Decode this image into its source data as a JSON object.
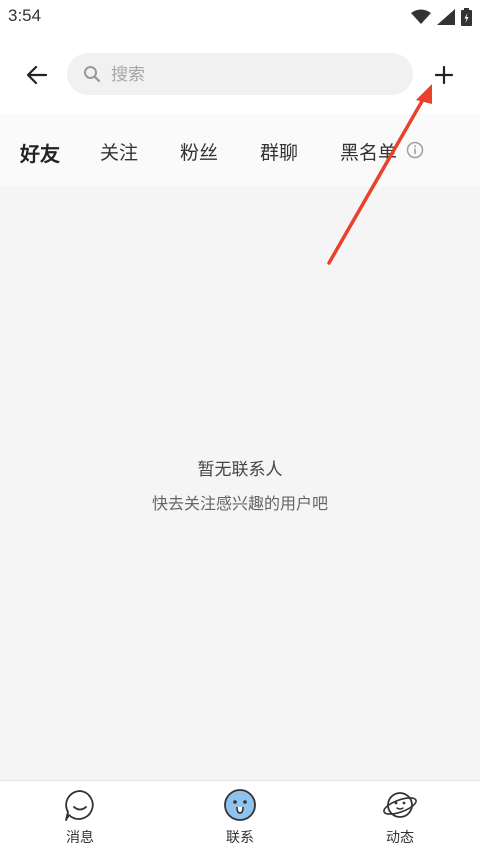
{
  "status_bar": {
    "time": "3:54"
  },
  "header": {
    "search_placeholder": "搜索"
  },
  "tabs": [
    {
      "label": "好友",
      "active": true
    },
    {
      "label": "关注",
      "active": false
    },
    {
      "label": "粉丝",
      "active": false
    },
    {
      "label": "群聊",
      "active": false
    },
    {
      "label": "黑名单",
      "active": false
    }
  ],
  "empty_state": {
    "title": "暂无联系人",
    "subtitle": "快去关注感兴趣的用户吧"
  },
  "bottom_nav": [
    {
      "label": "消息",
      "icon": "chat-bubble-icon"
    },
    {
      "label": "联系",
      "icon": "contacts-face-icon",
      "active": true
    },
    {
      "label": "动态",
      "icon": "planet-icon"
    }
  ],
  "colors": {
    "annotation_arrow": "#e8412c",
    "active_nav_icon": "#8fc3ee"
  }
}
